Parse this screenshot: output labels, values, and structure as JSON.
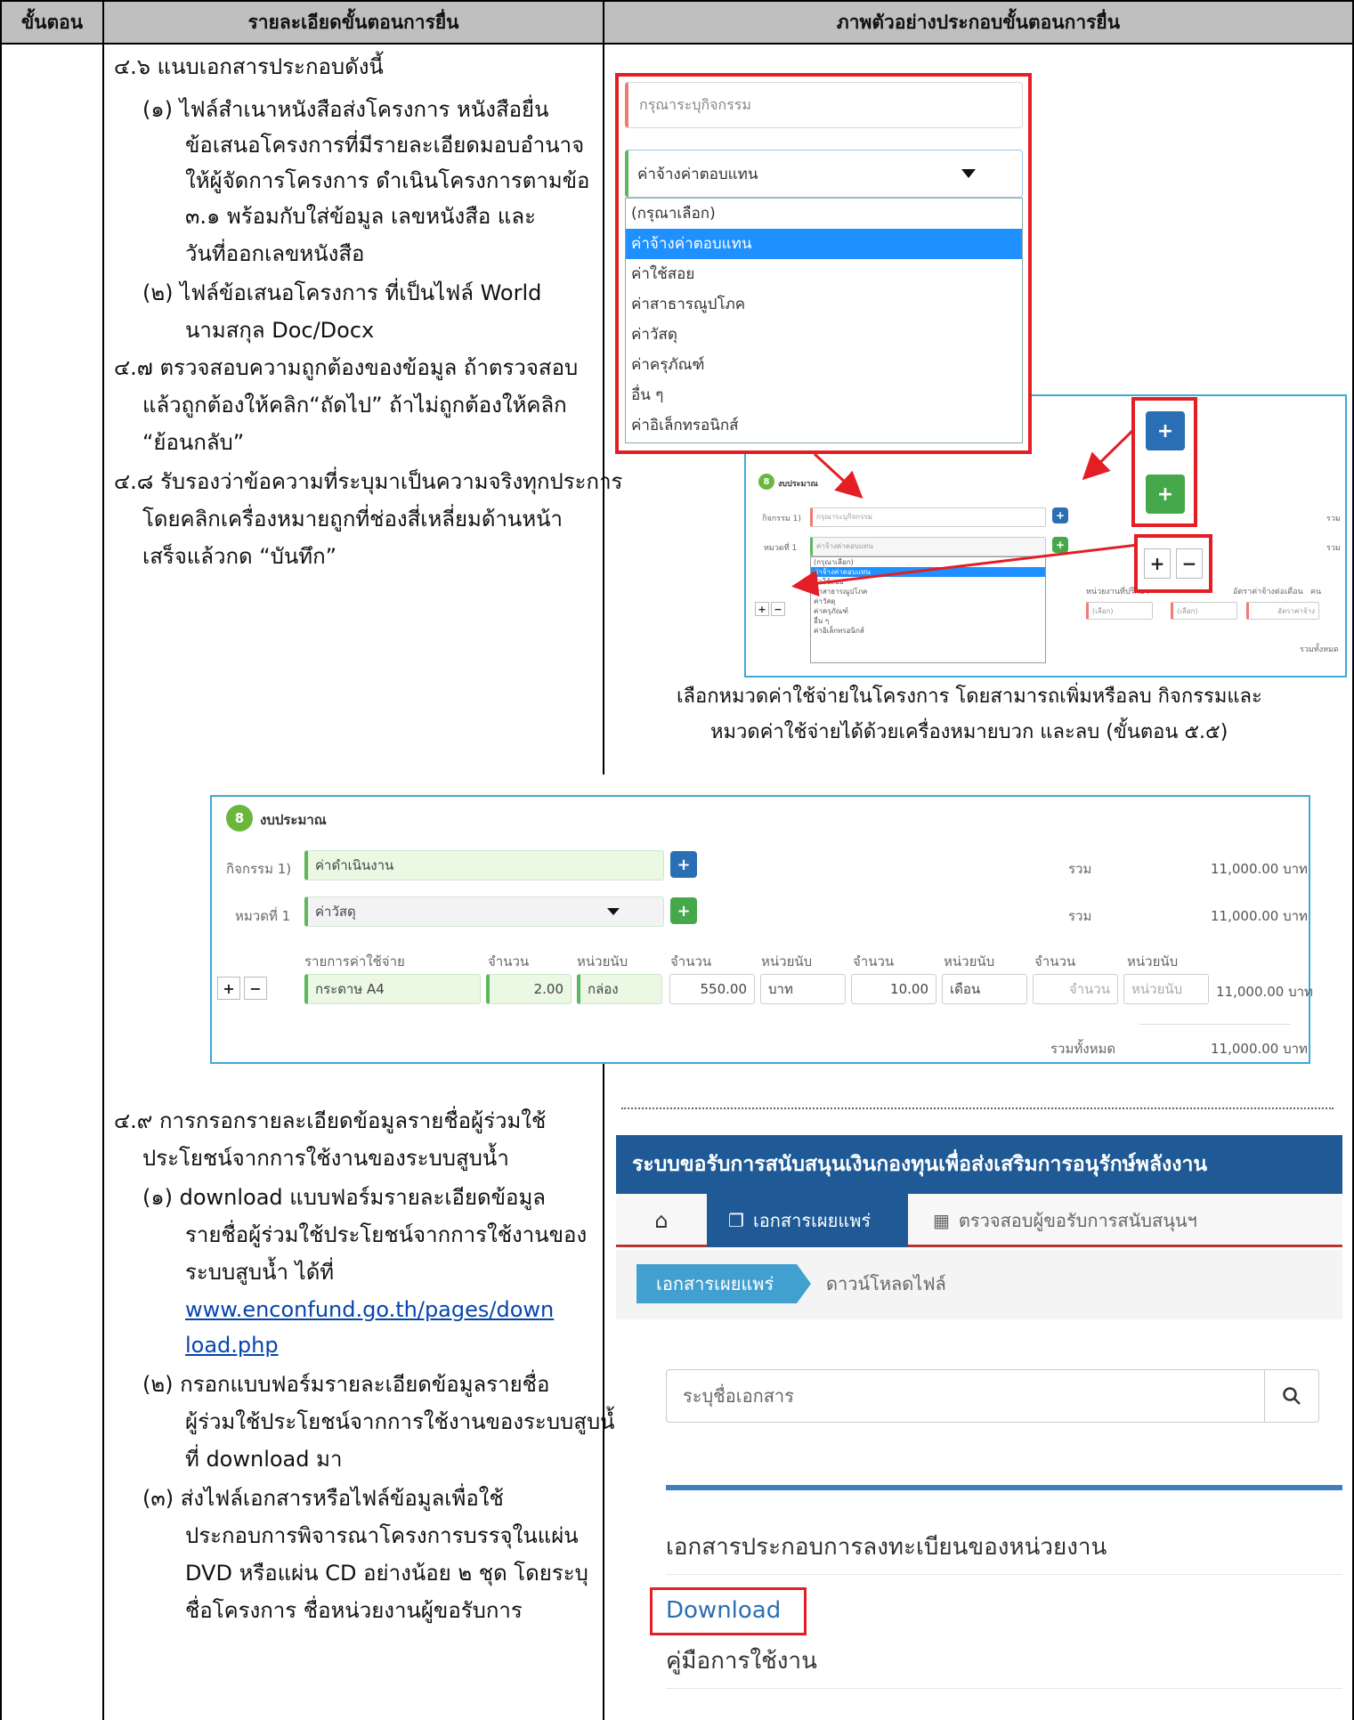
{
  "table": {
    "col1_header": "ขั้นตอน",
    "col2_header": "รายละเอียดขั้นตอนการยื่น",
    "col3_header": "ภาพตัวอย่างประกอบขั้นตอนการยื่น"
  },
  "steps": {
    "s46_title": "๔.๖ แนบเอกสารประกอบดังนี้",
    "s46_1_a": "(๑) ไฟล์สำเนาหนังสือส่งโครงการ หนังสือยื่น",
    "s46_1_b": "ข้อเสนอโครงการที่มีรายละเอียดมอบอำนาจ",
    "s46_1_c": "ให้ผู้จัดการโครงการ ดำเนินโครงการตามข้อ",
    "s46_1_d": "๓.๑ พร้อมกับใส่ข้อมูล เลขหนังสือ และ",
    "s46_1_e": "วันที่ออกเลขหนังสือ",
    "s46_2_a": "(๒) ไฟล์ข้อเสนอโครงการ ที่เป็นไฟล์ World",
    "s46_2_b": "นามสกุล Doc/Docx",
    "s47_a": "๔.๗ ตรวจสอบความถูกต้องของข้อมูล ถ้าตรวจสอบ",
    "s47_b": "แล้วถูกต้องให้คลิก“ถัดไป” ถ้าไม่ถูกต้องให้คลิก",
    "s47_c": "“ย้อนกลับ”",
    "s48_a": "๔.๘ รับรองว่าข้อความที่ระบุมาเป็นความจริงทุกประการ",
    "s48_b": "โดยคลิกเครื่องหมายถูกที่ช่องสี่เหลี่ยมด้านหน้า",
    "s48_c": "เสร็จแล้วกด “บันทึก”",
    "s49_a": "๔.๙  การกรอกรายละเอียดข้อมูลรายชื่อผู้ร่วมใช้",
    "s49_b": "ประโยชน์จากการใช้งานของระบบสูบน้ำ",
    "s49_1_a": "(๑) download แบบฟอร์มรายละเอียดข้อมูล",
    "s49_1_b": "รายชื่อผู้ร่วมใช้ประโยชน์จากการใช้งานของ",
    "s49_1_c": "ระบบสูบน้ำ ได้ที่",
    "s49_link_a": "www.enconfund.go.th/pages/down",
    "s49_link_b": "load.php",
    "s49_2_a": "(๒) กรอกแบบฟอร์มรายละเอียดข้อมูลรายชื่อ",
    "s49_2_b": "ผู้ร่วมใช้ประโยชน์จากการใช้งานของระบบสูบน้ำ",
    "s49_2_c": "ที่ download มา",
    "s49_3_a": "(๓) ส่งไฟล์เอกสารหรือไฟล์ข้อมูลเพื่อใช้",
    "s49_3_b": "ประกอบการพิจารณาโครงการบรรจุในแผ่น",
    "s49_3_c": "DVD หรือแผ่น CD อย่างน้อย ๒ ชุด โดยระบุ",
    "s49_3_d": "ชื่อโครงการ ชื่อหน่วยงานผู้ขอรับการ"
  },
  "dropdown_shot": {
    "activity_placeholder": "กรุณาระบุกิจกรรม",
    "selected": "ค่าจ้างค่าตอบแทน",
    "options": [
      "(กรุณาเลือก)",
      "ค่าจ้างค่าตอบแทน",
      "ค่าใช้สอย",
      "ค่าสาธารณูปโภค",
      "ค่าวัสดุ",
      "ค่าครุภัณฑ์",
      "อื่น ๆ",
      "ค่าอิเล็กทรอนิกส์"
    ]
  },
  "mini_shot": {
    "badge": "8",
    "section": "งบประมาณ",
    "activity_label": "กิจกรรม 1)",
    "activity_placeholder": "กรุณาระบุกิจกรรม",
    "category_label": "หมวดที่ 1",
    "category_value": "ค่าจ้างค่าตอบแทน",
    "options": [
      "(กรุณาเลือก)",
      "ค่าจ้างค่าตอบแทน",
      "ค่าใช้สอย",
      "ค่าสาธารณูปโภค",
      "ค่าวัสดุ",
      "ค่าครุภัณฑ์",
      "อื่น ๆ",
      "ค่าอิเล็กทรอนิกส์"
    ],
    "unit_label": "หน่วยงานที่ปรึกษา",
    "rate_label": "อัตราค่าจ้างต่อเดือน",
    "people_label": "คน",
    "sum_label": "รวม",
    "total_label": "รวมทั้งหมด",
    "select_label": "(เลือก)",
    "rate_placeholder": "อัตราค่าจ้าง"
  },
  "caption": {
    "line1": "เลือกหมวดค่าใช้จ่ายในโครงการ โดยสามารถเพิ่มหรือลบ กิจกรรมและ",
    "line2": "หมวดค่าใช้จ่ายได้ด้วยเครื่องหมายบวก และลบ (ขั้นตอน ๕.๕)"
  },
  "big_shot": {
    "badge": "8",
    "section": "งบประมาณ",
    "activity_label": "กิจกรรม 1)",
    "activity_value": "ค่าดำเนินงาน",
    "category_label": "หมวดที่ 1",
    "category_value": "ค่าวัสดุ",
    "sum_label": "รวม",
    "sum_value_1": "11,000.00 บาท",
    "sum_value_2": "11,000.00 บาท",
    "col_item": "รายการค่าใช้จ่าย",
    "col_qty1": "จำนวน",
    "col_unit1": "หน่วยนับ",
    "col_qty2": "จำนวน",
    "col_unit2": "หน่วยนับ",
    "col_qty3": "จำนวน",
    "col_unit3": "หน่วยนับ",
    "col_qty4": "จำนวน",
    "col_unit4": "หน่วยนับ",
    "item_value": "กระดาษ A4",
    "qty1_value": "2.00",
    "unit1_value": "กล่อง",
    "qty2_value": "550.00",
    "unit2_value": "บาท",
    "qty3_value": "10.00",
    "unit3_value": "เดือน",
    "qty4_placeholder": "จำนวน",
    "unit4_placeholder": "หน่วยนับ",
    "row_total": "11,000.00 บาท",
    "grand_label": "รวมทั้งหมด",
    "grand_value": "11,000.00 บาท"
  },
  "portal": {
    "title": "ระบบขอรับการสนับสนุนเงินกองทุนเพื่อส่งเสริมการอนุรักษ์พลังงาน",
    "tab_docs": "เอกสารเผยแพร่",
    "tab_check": "ตรวจสอบผู้ขอรับการสนับสนุนฯ",
    "crumb_1": "เอกสารเผยแพร่",
    "crumb_2": "ดาวน์โหลดไฟล์",
    "search_placeholder": "ระบุชื่อเอกสาร",
    "doc_heading": "เอกสารประกอบการลงทะเบียนของหน่วยงาน",
    "download": "Download",
    "manual": "คู่มือการใช้งาน"
  },
  "colors": {
    "header_bg": "#bfbfbf",
    "highlight_red": "#e41e25",
    "frame_blue": "#3fa9d6",
    "portal_blue": "#1f5a96",
    "link_blue": "#0645ad"
  }
}
